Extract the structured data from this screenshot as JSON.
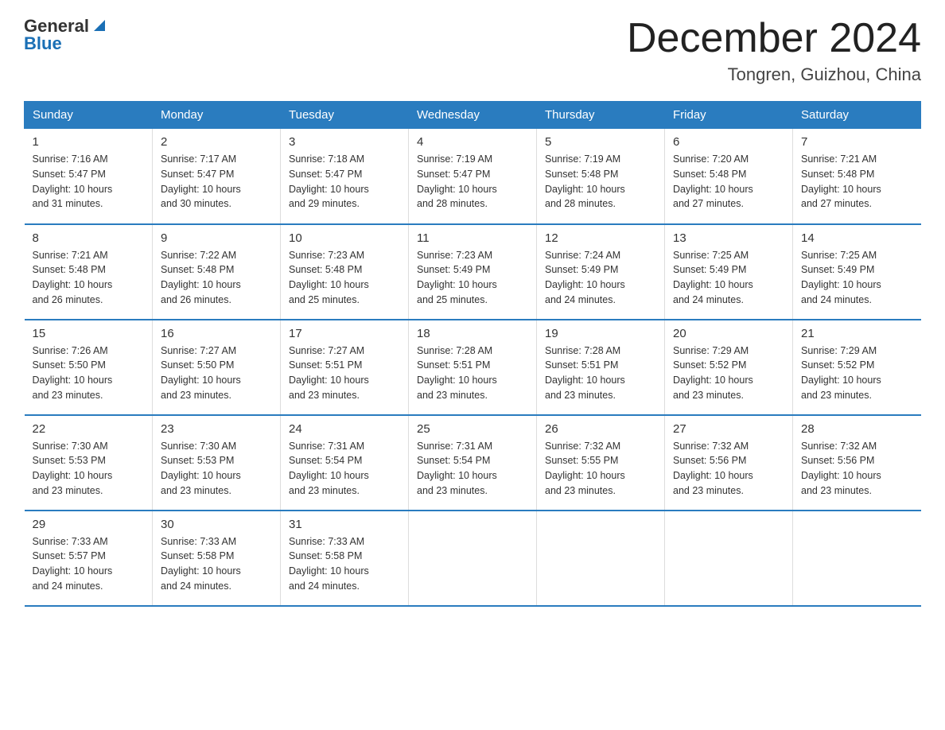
{
  "header": {
    "logo_general": "General",
    "logo_blue": "Blue",
    "month_title": "December 2024",
    "location": "Tongren, Guizhou, China"
  },
  "weekdays": [
    "Sunday",
    "Monday",
    "Tuesday",
    "Wednesday",
    "Thursday",
    "Friday",
    "Saturday"
  ],
  "weeks": [
    [
      {
        "day": "1",
        "sunrise": "7:16 AM",
        "sunset": "5:47 PM",
        "daylight": "10 hours and 31 minutes."
      },
      {
        "day": "2",
        "sunrise": "7:17 AM",
        "sunset": "5:47 PM",
        "daylight": "10 hours and 30 minutes."
      },
      {
        "day": "3",
        "sunrise": "7:18 AM",
        "sunset": "5:47 PM",
        "daylight": "10 hours and 29 minutes."
      },
      {
        "day": "4",
        "sunrise": "7:19 AM",
        "sunset": "5:47 PM",
        "daylight": "10 hours and 28 minutes."
      },
      {
        "day": "5",
        "sunrise": "7:19 AM",
        "sunset": "5:48 PM",
        "daylight": "10 hours and 28 minutes."
      },
      {
        "day": "6",
        "sunrise": "7:20 AM",
        "sunset": "5:48 PM",
        "daylight": "10 hours and 27 minutes."
      },
      {
        "day": "7",
        "sunrise": "7:21 AM",
        "sunset": "5:48 PM",
        "daylight": "10 hours and 27 minutes."
      }
    ],
    [
      {
        "day": "8",
        "sunrise": "7:21 AM",
        "sunset": "5:48 PM",
        "daylight": "10 hours and 26 minutes."
      },
      {
        "day": "9",
        "sunrise": "7:22 AM",
        "sunset": "5:48 PM",
        "daylight": "10 hours and 26 minutes."
      },
      {
        "day": "10",
        "sunrise": "7:23 AM",
        "sunset": "5:48 PM",
        "daylight": "10 hours and 25 minutes."
      },
      {
        "day": "11",
        "sunrise": "7:23 AM",
        "sunset": "5:49 PM",
        "daylight": "10 hours and 25 minutes."
      },
      {
        "day": "12",
        "sunrise": "7:24 AM",
        "sunset": "5:49 PM",
        "daylight": "10 hours and 24 minutes."
      },
      {
        "day": "13",
        "sunrise": "7:25 AM",
        "sunset": "5:49 PM",
        "daylight": "10 hours and 24 minutes."
      },
      {
        "day": "14",
        "sunrise": "7:25 AM",
        "sunset": "5:49 PM",
        "daylight": "10 hours and 24 minutes."
      }
    ],
    [
      {
        "day": "15",
        "sunrise": "7:26 AM",
        "sunset": "5:50 PM",
        "daylight": "10 hours and 23 minutes."
      },
      {
        "day": "16",
        "sunrise": "7:27 AM",
        "sunset": "5:50 PM",
        "daylight": "10 hours and 23 minutes."
      },
      {
        "day": "17",
        "sunrise": "7:27 AM",
        "sunset": "5:51 PM",
        "daylight": "10 hours and 23 minutes."
      },
      {
        "day": "18",
        "sunrise": "7:28 AM",
        "sunset": "5:51 PM",
        "daylight": "10 hours and 23 minutes."
      },
      {
        "day": "19",
        "sunrise": "7:28 AM",
        "sunset": "5:51 PM",
        "daylight": "10 hours and 23 minutes."
      },
      {
        "day": "20",
        "sunrise": "7:29 AM",
        "sunset": "5:52 PM",
        "daylight": "10 hours and 23 minutes."
      },
      {
        "day": "21",
        "sunrise": "7:29 AM",
        "sunset": "5:52 PM",
        "daylight": "10 hours and 23 minutes."
      }
    ],
    [
      {
        "day": "22",
        "sunrise": "7:30 AM",
        "sunset": "5:53 PM",
        "daylight": "10 hours and 23 minutes."
      },
      {
        "day": "23",
        "sunrise": "7:30 AM",
        "sunset": "5:53 PM",
        "daylight": "10 hours and 23 minutes."
      },
      {
        "day": "24",
        "sunrise": "7:31 AM",
        "sunset": "5:54 PM",
        "daylight": "10 hours and 23 minutes."
      },
      {
        "day": "25",
        "sunrise": "7:31 AM",
        "sunset": "5:54 PM",
        "daylight": "10 hours and 23 minutes."
      },
      {
        "day": "26",
        "sunrise": "7:32 AM",
        "sunset": "5:55 PM",
        "daylight": "10 hours and 23 minutes."
      },
      {
        "day": "27",
        "sunrise": "7:32 AM",
        "sunset": "5:56 PM",
        "daylight": "10 hours and 23 minutes."
      },
      {
        "day": "28",
        "sunrise": "7:32 AM",
        "sunset": "5:56 PM",
        "daylight": "10 hours and 23 minutes."
      }
    ],
    [
      {
        "day": "29",
        "sunrise": "7:33 AM",
        "sunset": "5:57 PM",
        "daylight": "10 hours and 24 minutes."
      },
      {
        "day": "30",
        "sunrise": "7:33 AM",
        "sunset": "5:58 PM",
        "daylight": "10 hours and 24 minutes."
      },
      {
        "day": "31",
        "sunrise": "7:33 AM",
        "sunset": "5:58 PM",
        "daylight": "10 hours and 24 minutes."
      },
      null,
      null,
      null,
      null
    ]
  ],
  "labels": {
    "sunrise": "Sunrise:",
    "sunset": "Sunset:",
    "daylight": "Daylight:"
  }
}
